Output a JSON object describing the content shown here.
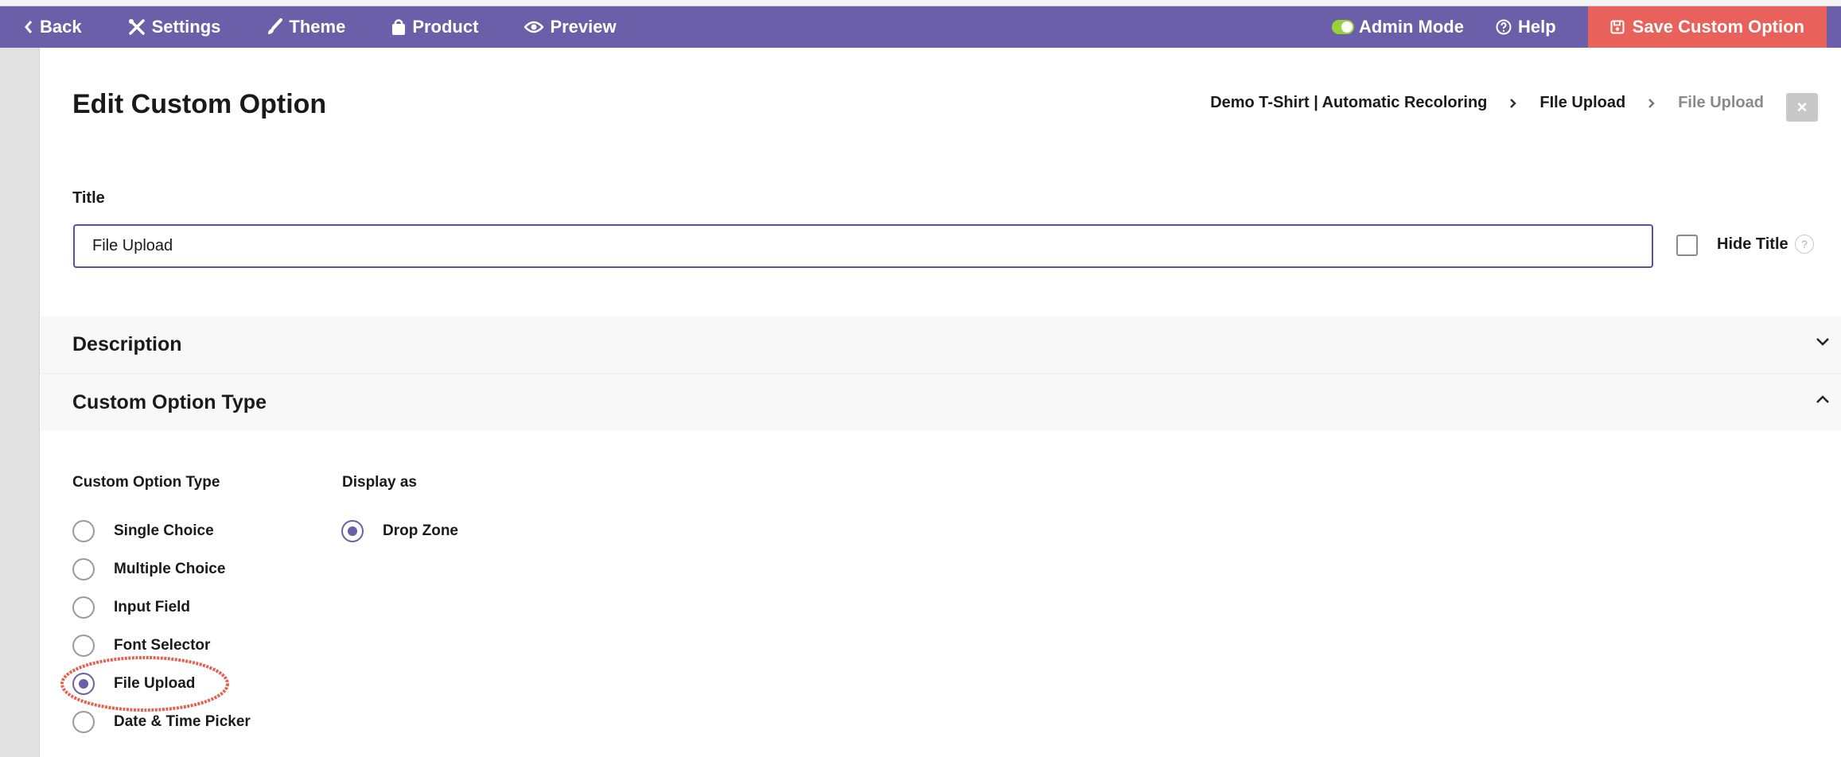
{
  "navbar": {
    "back_label": "Back",
    "settings_label": "Settings",
    "theme_label": "Theme",
    "product_label": "Product",
    "preview_label": "Preview",
    "admin_mode_label": "Admin Mode",
    "help_label": "Help",
    "save_label": "Save Custom Option",
    "bar_color": "#6a5fa8",
    "save_color": "#e8615b",
    "toggle_color": "#9ad13a"
  },
  "page": {
    "title": "Edit Custom Option",
    "breadcrumb": [
      "Demo T-Shirt | Automatic Recoloring",
      "FIle Upload",
      "File Upload"
    ],
    "close_symbol": "×"
  },
  "title_field": {
    "label": "Title",
    "value": "File Upload",
    "hide_title_label": "Hide Title",
    "hide_title_checked": false,
    "help_symbol": "?"
  },
  "sections": {
    "description": {
      "label": "Description",
      "expanded": false
    },
    "custom_option_type": {
      "label": "Custom Option Type",
      "expanded": true
    }
  },
  "option_type": {
    "heading": "Custom Option Type",
    "options": [
      {
        "label": "Single Choice",
        "selected": false
      },
      {
        "label": "Multiple Choice",
        "selected": false
      },
      {
        "label": "Input Field",
        "selected": false
      },
      {
        "label": "Font Selector",
        "selected": false
      },
      {
        "label": "File Upload",
        "selected": true
      },
      {
        "label": "Date & Time Picker",
        "selected": false
      }
    ]
  },
  "display_as": {
    "heading": "Display as",
    "options": [
      {
        "label": "Drop Zone",
        "selected": true
      }
    ]
  },
  "annotation": {
    "color": "#e2624f"
  }
}
